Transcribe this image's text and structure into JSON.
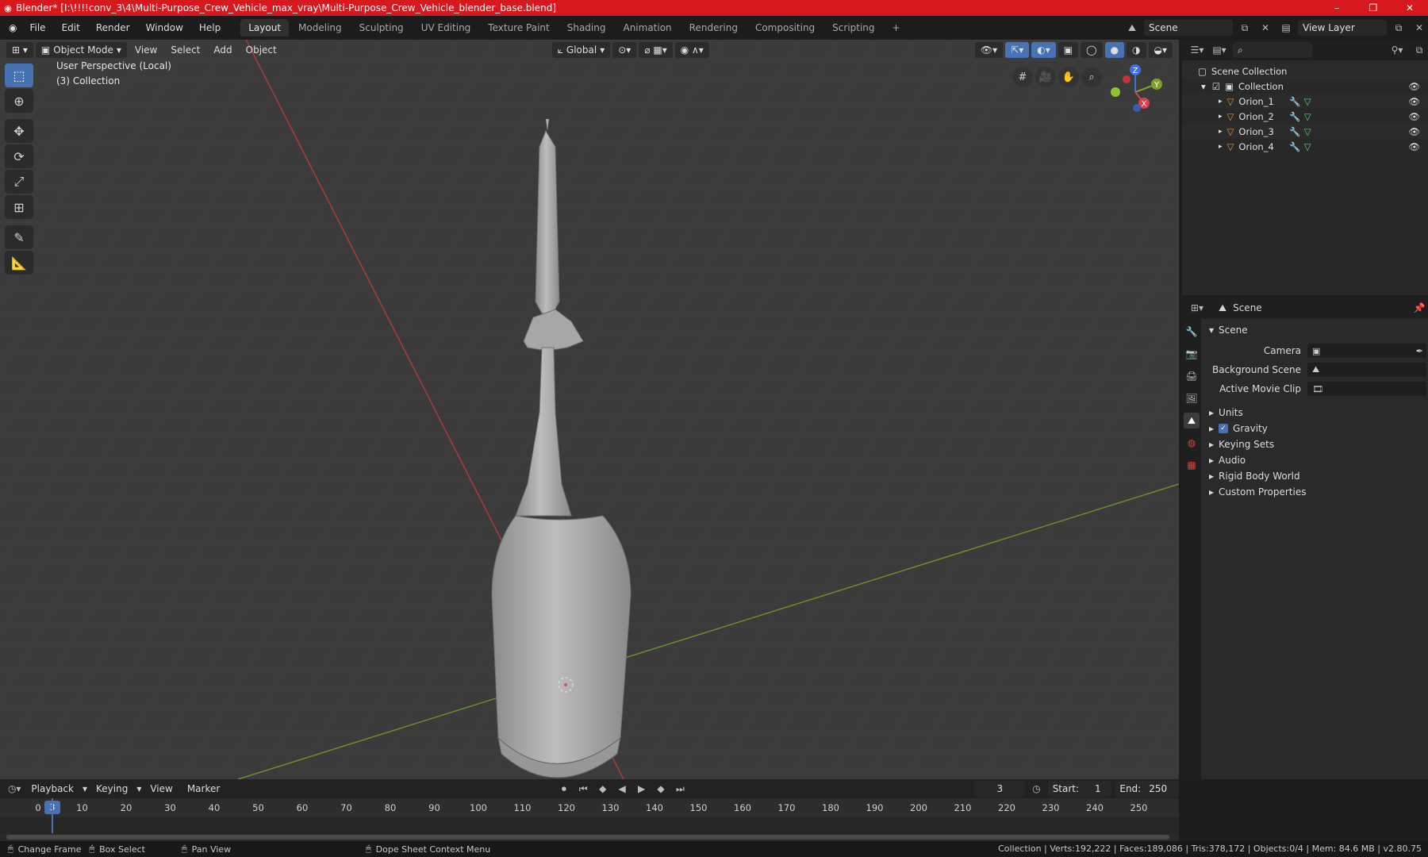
{
  "window": {
    "title": "Blender* [I:\\!!!!conv_3\\4\\Multi-Purpose_Crew_Vehicle_max_vray\\Multi-Purpose_Crew_Vehicle_blender_base.blend]",
    "minimize": "–",
    "maximize": "❐",
    "close": "✕"
  },
  "menu": [
    "File",
    "Edit",
    "Render",
    "Window",
    "Help"
  ],
  "workspaces": [
    "Layout",
    "Modeling",
    "Sculpting",
    "UV Editing",
    "Texture Paint",
    "Shading",
    "Animation",
    "Rendering",
    "Compositing",
    "Scripting"
  ],
  "workspace_add": "+",
  "topright": {
    "scene": "Scene",
    "view_layer": "View Layer"
  },
  "viewport": {
    "mode": "Object Mode",
    "menus": [
      "View",
      "Select",
      "Add",
      "Object"
    ],
    "orientation": "Global",
    "info_line1": "User Perspective (Local)",
    "info_line2": "(3) Collection",
    "gizmo": {
      "z": "Z",
      "y": "Y",
      "x": "X"
    }
  },
  "outliner": {
    "root": "Scene Collection",
    "collection": "Collection",
    "objects": [
      "Orion_1",
      "Orion_2",
      "Orion_3",
      "Orion_4"
    ]
  },
  "properties": {
    "header": "Scene",
    "panel_title": "Scene",
    "camera_label": "Camera",
    "background_label": "Background Scene",
    "movieclip_label": "Active Movie Clip",
    "subpanels": [
      "Units",
      "Gravity",
      "Keying Sets",
      "Audio",
      "Rigid Body World",
      "Custom Properties"
    ]
  },
  "timeline": {
    "menus": [
      "Playback",
      "Keying",
      "View",
      "Marker"
    ],
    "current_frame": "3",
    "start_label": "Start:",
    "start": "1",
    "end_label": "End:",
    "end": "250",
    "ruler": [
      "0",
      "10",
      "20",
      "30",
      "40",
      "50",
      "60",
      "70",
      "80",
      "90",
      "100",
      "110",
      "120",
      "130",
      "140",
      "150",
      "160",
      "170",
      "180",
      "190",
      "200",
      "210",
      "220",
      "230",
      "240",
      "250"
    ],
    "cursor_label": "3"
  },
  "status": {
    "hints": [
      "Change Frame",
      "Box Select",
      "Pan View",
      "Dope Sheet Context Menu"
    ],
    "stats": "Collection | Verts:192,222 | Faces:189,086 | Tris:378,172 | Objects:0/4 | Mem: 84.6 MB | v2.80.75"
  }
}
